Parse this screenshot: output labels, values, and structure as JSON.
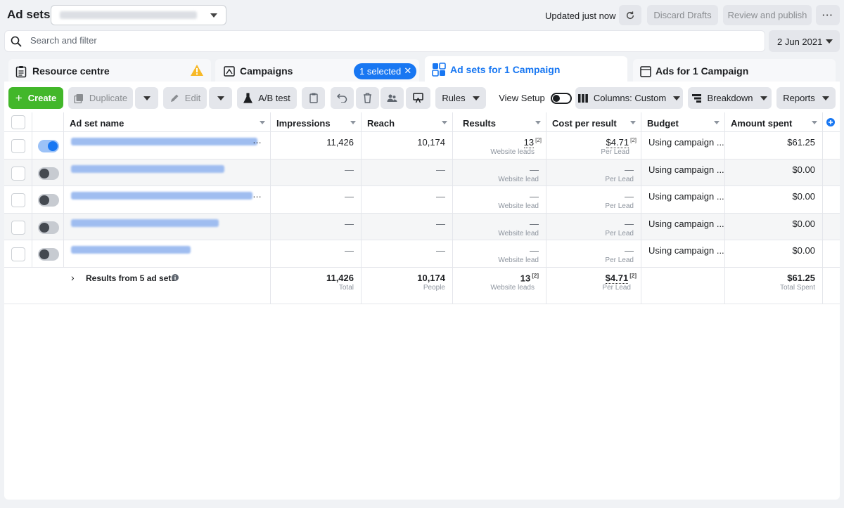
{
  "header": {
    "title": "Ad sets",
    "updated": "Updated just now",
    "discard_label": "Discard Drafts",
    "review_label": "Review and publish",
    "more_label": "···"
  },
  "search": {
    "placeholder": "Search and filter"
  },
  "date_range": "2 Jun 2021",
  "tabs": {
    "resource": "Resource centre",
    "campaigns": "Campaigns",
    "selected_badge": "1 selected",
    "adsets": "Ad sets for 1 Campaign",
    "ads": "Ads for 1 Campaign"
  },
  "toolbar": {
    "create": "Create",
    "duplicate": "Duplicate",
    "edit": "Edit",
    "ab_test": "A/B test",
    "rules": "Rules",
    "view_setup": "View Setup",
    "columns": "Columns: Custom",
    "breakdown": "Breakdown",
    "reports": "Reports"
  },
  "table": {
    "columns": [
      "Ad set name",
      "Impressions",
      "Reach",
      "Results",
      "Cost per result",
      "Budget",
      "Amount spent"
    ],
    "rows": [
      {
        "on": true,
        "impressions": "11,426",
        "reach": "10,174",
        "results": "13",
        "results_sub": "Website leads",
        "cpr": "$4.71",
        "cpr_sub": "Per Lead",
        "budget": "Using campaign ...",
        "spent": "$61.25"
      },
      {
        "on": false,
        "impressions": "—",
        "reach": "—",
        "results": "—",
        "results_sub": "Website lead",
        "cpr": "—",
        "cpr_sub": "Per Lead",
        "budget": "Using campaign ...",
        "spent": "$0.00"
      },
      {
        "on": false,
        "impressions": "—",
        "reach": "—",
        "results": "—",
        "results_sub": "Website lead",
        "cpr": "—",
        "cpr_sub": "Per Lead",
        "budget": "Using campaign ...",
        "spent": "$0.00"
      },
      {
        "on": false,
        "impressions": "—",
        "reach": "—",
        "results": "—",
        "results_sub": "Website lead",
        "cpr": "—",
        "cpr_sub": "Per Lead",
        "budget": "Using campaign ...",
        "spent": "$0.00"
      },
      {
        "on": false,
        "impressions": "—",
        "reach": "—",
        "results": "—",
        "results_sub": "Website lead",
        "cpr": "—",
        "cpr_sub": "Per Lead",
        "budget": "Using campaign ...",
        "spent": "$0.00"
      }
    ],
    "footnote": "[2]",
    "totals": {
      "label": "Results from 5 ad sets",
      "impressions": "11,426",
      "impressions_sub": "Total",
      "reach": "10,174",
      "reach_sub": "People",
      "results": "13",
      "results_sub": "Website leads",
      "cpr": "$4.71",
      "cpr_sub": "Per Lead",
      "spent": "$61.25",
      "spent_sub": "Total Spent"
    }
  }
}
